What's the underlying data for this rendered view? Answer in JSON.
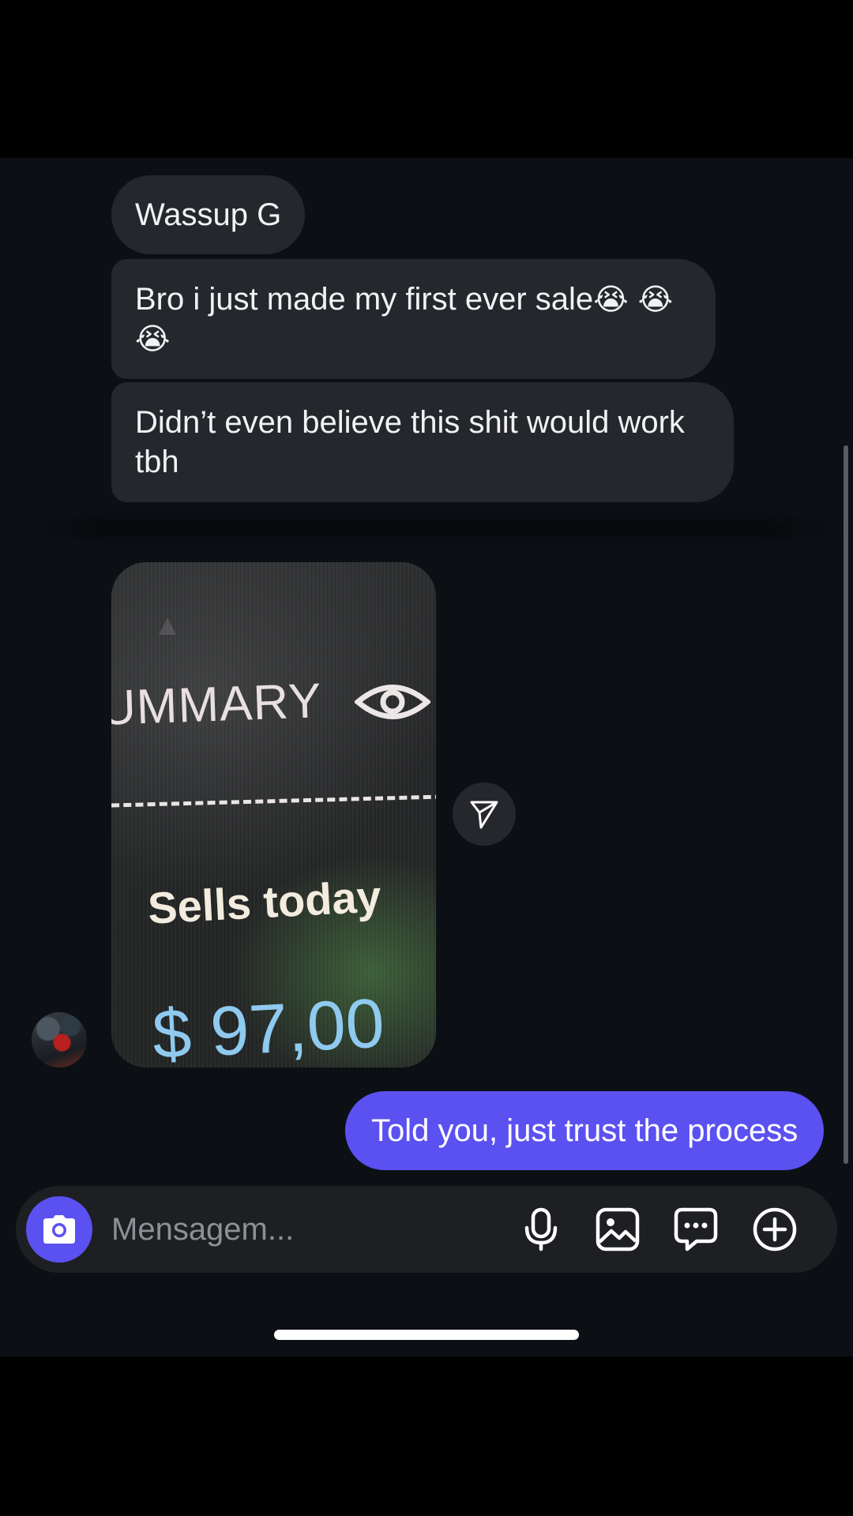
{
  "chat": {
    "messages": [
      {
        "from": "them",
        "text": "Wassup G"
      },
      {
        "from": "them",
        "text": "Bro i just made my first ever sale",
        "emoji": "😭 😭 😭"
      },
      {
        "from": "them",
        "text": "Didn’t even believe this shit would work tbh"
      },
      {
        "from": "them",
        "type": "photo",
        "photo_text": {
          "summary": "UMMARY",
          "sells_label": "Sells today",
          "amount": "$ 97,00"
        }
      },
      {
        "from": "me",
        "text": "Told you, just trust the process"
      }
    ]
  },
  "composer": {
    "placeholder": "Mensagem...",
    "value": ""
  },
  "icons": [
    "send-share-icon",
    "camera-icon",
    "microphone-icon",
    "gallery-icon",
    "chat-bubble-icon",
    "plus-circle-icon"
  ],
  "colors": {
    "background": "#0c1015",
    "incoming_bubble": "#25272c",
    "outgoing_bubble": "#5b51f1",
    "camera_button": "#5b51f1"
  }
}
